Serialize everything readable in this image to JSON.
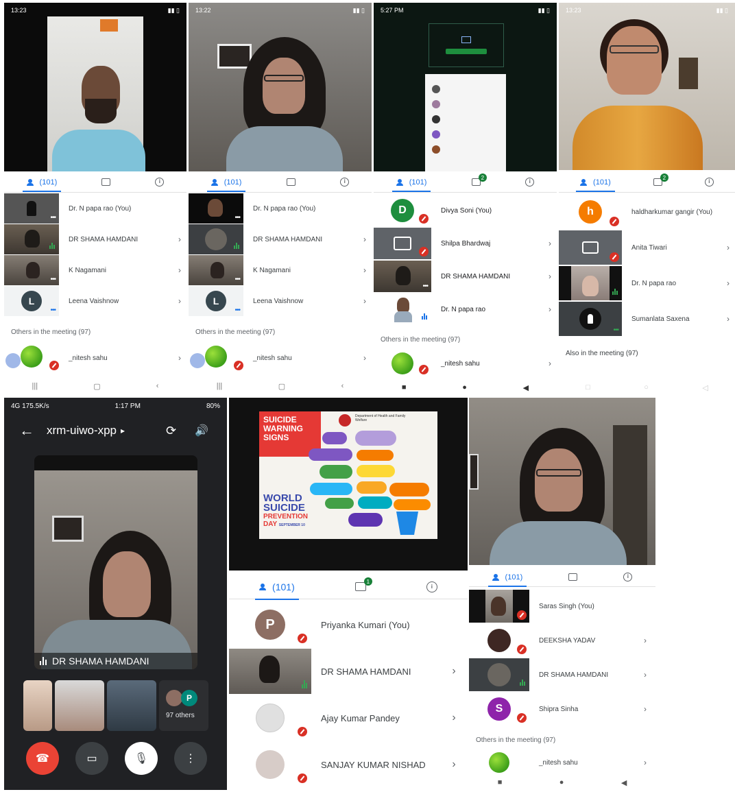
{
  "panels": {
    "p1": {
      "status_time": "13:23",
      "tab_people": "(101)",
      "participants": [
        "Dr. N papa rao (You)",
        "DR SHAMA HAMDANI",
        "K Nagamani",
        "Leena Vaishnow"
      ],
      "avatar_letters": [
        "L"
      ],
      "others_label": "Others in the meeting (97)",
      "other_name": "_nitesh sahu"
    },
    "p2": {
      "status_time": "13:22",
      "tab_people": "(101)",
      "participants": [
        "Dr. N papa rao (You)",
        "DR SHAMA HAMDANI",
        "K Nagamani",
        "Leena Vaishnow"
      ],
      "avatar_letters": [
        "L"
      ],
      "others_label": "Others in the meeting (97)",
      "other_name": "_nitesh sahu"
    },
    "p3": {
      "status_time": "5:27 PM",
      "tab_people": "(101)",
      "chat_badge": "2",
      "participants": [
        "Divya Soni (You)",
        "Shilpa Bhardwaj",
        "DR SHAMA HAMDANI",
        "Dr. N papa rao"
      ],
      "avatar_letters": [
        "D"
      ],
      "others_label": "Others in the meeting (97)",
      "other_name": "_nitesh sahu"
    },
    "p4": {
      "status_time": "13:23",
      "tab_people": "(101)",
      "chat_badge": "2",
      "participants": [
        "haldharkumar gangir (You)",
        "Anita Tiwari",
        "Dr. N papa rao",
        "Sumanlata Saxena"
      ],
      "avatar_letters": [
        "h"
      ],
      "others_label": "Also in the meeting (97)"
    },
    "p5": {
      "status_time": "1:17 PM",
      "status_left": "4G 175.5K/s",
      "battery": "80%",
      "meeting_code": "xrm-uiwo-xpp",
      "speaker_name": "DR SHAMA HAMDANI",
      "others_count": "97 others",
      "avatar_letters": [
        "P"
      ]
    },
    "p6": {
      "tab_people": "(101)",
      "chat_badge": "1",
      "poster": {
        "headline": [
          "SUICIDE",
          "WARNING",
          "SIGNS"
        ],
        "dept": "Department of Health and Family Welfare",
        "footer": [
          "WORLD",
          "SUICIDE",
          "PREVENTION",
          "DAY"
        ],
        "footer_date": "SEPTEMBER 10"
      },
      "participants": [
        "Priyanka Kumari (You)",
        "DR SHAMA HAMDANI",
        "Ajay Kumar Pandey",
        "SANJAY KUMAR NISHAD"
      ],
      "avatar_letters": [
        "P"
      ]
    },
    "p7": {
      "tab_people": "(101)",
      "participants": [
        "Saras Singh (You)",
        "DEEKSHA YADAV",
        "DR SHAMA HAMDANI",
        "Shipra Sinha"
      ],
      "avatar_letters": [
        "S"
      ],
      "others_label": "Others in the meeting (97)",
      "other_name": "_nitesh sahu"
    }
  },
  "colors": {
    "accent": "#1a73e8",
    "mic_off": "#d93025",
    "speaking": "#34a853",
    "end_call": "#ea4335",
    "poster_red": "#e53935",
    "dark_bg": "#202124"
  },
  "icons": [
    "people-icon",
    "chat-icon",
    "info-icon",
    "chevron-right-icon",
    "mic-off-icon",
    "end-call-icon",
    "camera-icon",
    "mic-icon",
    "more-icon",
    "back-icon",
    "switch-camera-icon",
    "speaker-icon"
  ]
}
